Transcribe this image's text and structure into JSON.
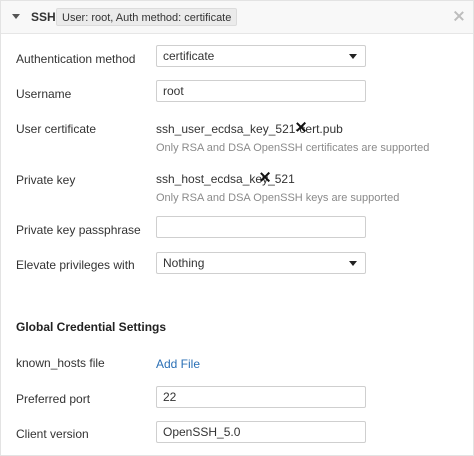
{
  "header": {
    "title": "SSH",
    "badge": "User: root, Auth method: certificate"
  },
  "form": {
    "auth_method": {
      "label": "Authentication method",
      "value": "certificate"
    },
    "username": {
      "label": "Username",
      "value": "root"
    },
    "user_certificate": {
      "label": "User certificate",
      "file": "ssh_user_ecdsa_key_521-cert.pub",
      "hint": "Only RSA and DSA OpenSSH certificates are supported"
    },
    "private_key": {
      "label": "Private key",
      "file": "ssh_host_ecdsa_key_521",
      "hint": "Only RSA and DSA OpenSSH keys are supported"
    },
    "passphrase": {
      "label": "Private key passphrase",
      "value": ""
    },
    "elevate": {
      "label": "Elevate privileges with",
      "value": "Nothing"
    }
  },
  "global": {
    "title": "Global Credential Settings",
    "known_hosts": {
      "label": "known_hosts file",
      "link": "Add File"
    },
    "port": {
      "label": "Preferred port",
      "value": "22"
    },
    "client_version": {
      "label": "Client version",
      "value": "OpenSSH_5.0"
    }
  }
}
